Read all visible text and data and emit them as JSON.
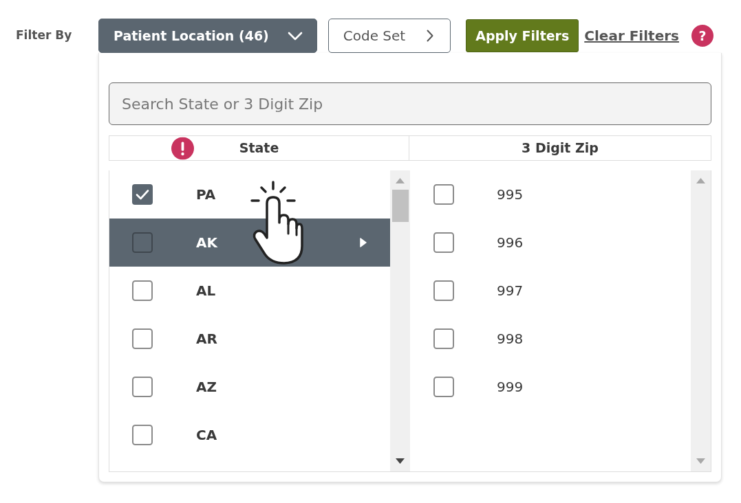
{
  "filter_bar": {
    "label": "Filter By",
    "filters": [
      {
        "label": "Patient Location (46)",
        "expanded": true
      },
      {
        "label": "Code Set",
        "expanded": false
      }
    ],
    "apply_button": "Apply Filters",
    "clear_link": "Clear Filters",
    "help": "?"
  },
  "panel": {
    "search": {
      "placeholder": "Search State or 3 Digit Zip"
    },
    "columns": [
      {
        "heading": "State",
        "warning": true,
        "scrollable": true,
        "items": [
          {
            "label": "PA",
            "checked": true,
            "selected": false
          },
          {
            "label": "AK",
            "checked": false,
            "selected": true
          },
          {
            "label": "AL",
            "checked": false,
            "selected": false
          },
          {
            "label": "AR",
            "checked": false,
            "selected": false
          },
          {
            "label": "AZ",
            "checked": false,
            "selected": false
          },
          {
            "label": "CA",
            "checked": false,
            "selected": false
          }
        ]
      },
      {
        "heading": "3 Digit Zip",
        "warning": false,
        "scrollable": false,
        "items": [
          {
            "label": "995",
            "checked": false,
            "selected": false
          },
          {
            "label": "996",
            "checked": false,
            "selected": false
          },
          {
            "label": "997",
            "checked": false,
            "selected": false
          },
          {
            "label": "998",
            "checked": false,
            "selected": false
          },
          {
            "label": "999",
            "checked": false,
            "selected": false
          }
        ]
      }
    ]
  }
}
